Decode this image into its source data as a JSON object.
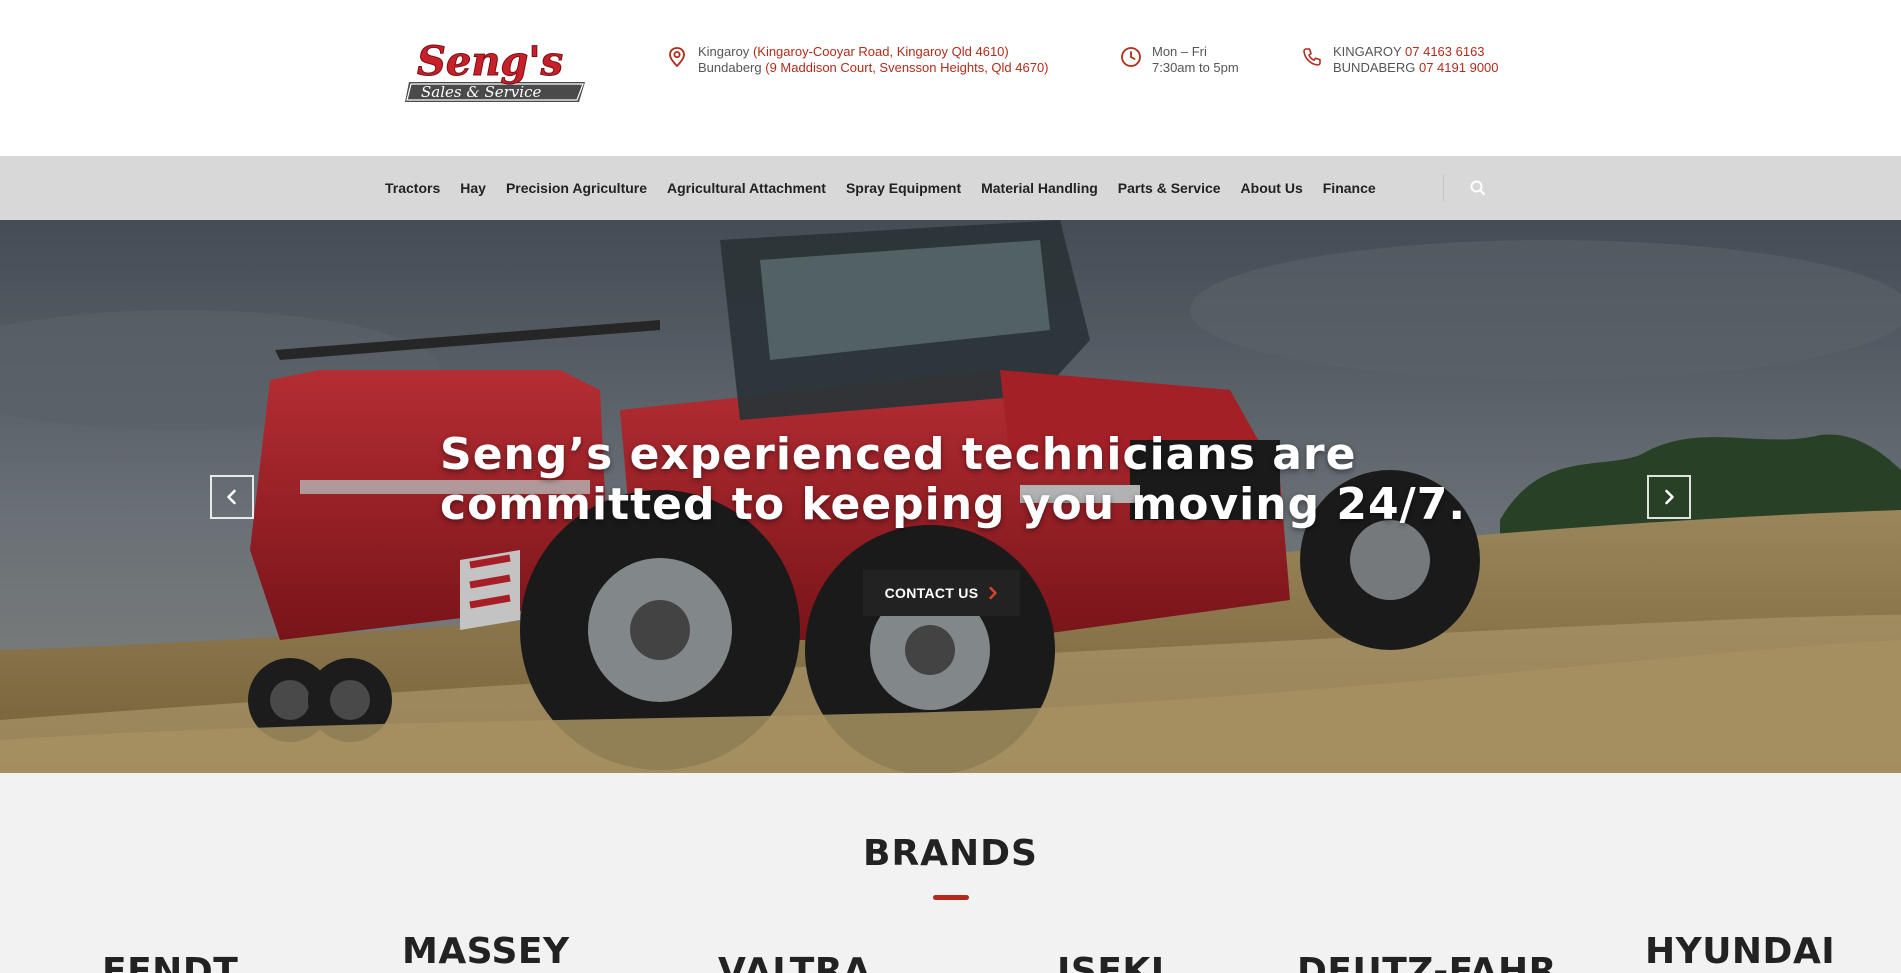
{
  "header": {
    "logo_alt": "Seng's Sales & Service",
    "logo_line1": "Seng's",
    "logo_line2": "Sales & Service",
    "location": {
      "line1_place": "Kingaroy",
      "line1_address": "(Kingaroy-Cooyar Road, Kingaroy Qld 4610)",
      "line2_place": "Bundaberg",
      "line2_address": "(9 Maddison Court, Svensson Heights, Qld 4670)"
    },
    "hours": {
      "days": "Mon – Fri",
      "time": "7:30am to 5pm"
    },
    "phone": {
      "line1_place": "KINGAROY",
      "line1_number": "07 4163 6163",
      "line2_place": "BUNDABERG",
      "line2_number": "07 4191 9000"
    }
  },
  "nav": {
    "items": [
      {
        "label": "Tractors"
      },
      {
        "label": "Hay"
      },
      {
        "label": "Precision Agriculture"
      },
      {
        "label": "Agricultural Attachment"
      },
      {
        "label": "Spray Equipment"
      },
      {
        "label": "Material Handling"
      },
      {
        "label": "Parts & Service"
      },
      {
        "label": "About Us"
      },
      {
        "label": "Finance"
      }
    ],
    "search_icon": "search-icon"
  },
  "hero": {
    "headline_line1": "Seng’s experienced technicians are",
    "headline_line2": "committed to keeping you moving 24/7.",
    "cta_label": "CONTACT US",
    "prev_icon": "chevron-left-icon",
    "next_icon": "chevron-right-icon"
  },
  "brands": {
    "title": "BRANDS",
    "items": [
      {
        "label": "FENDT"
      },
      {
        "label": "MASSEY"
      },
      {
        "label": "VALTRA"
      },
      {
        "label": "ISEKI"
      },
      {
        "label": "DEUTZ-FAHR"
      },
      {
        "label": "HYUNDAI"
      }
    ]
  },
  "colors": {
    "accent": "#b22b1a",
    "nav_bg": "#d8d8d8",
    "cta_bg": "#222222"
  }
}
